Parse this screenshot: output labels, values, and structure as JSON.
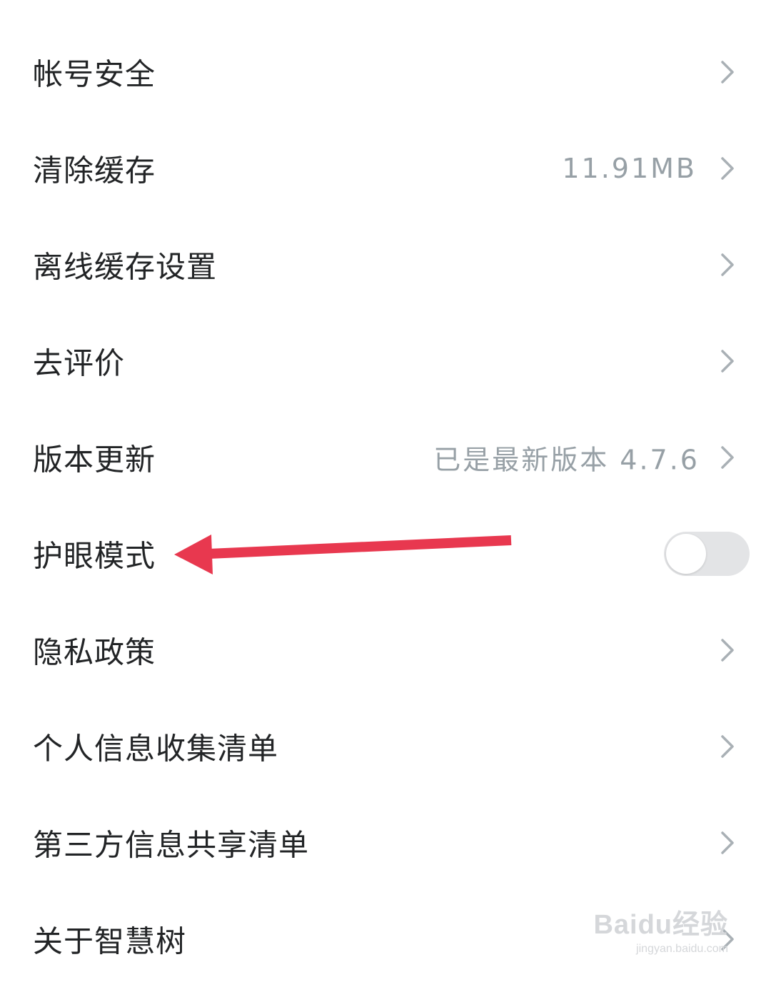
{
  "settings": {
    "rows": [
      {
        "label": "帐号安全",
        "value": ""
      },
      {
        "label": "清除缓存",
        "value": "11.91MB"
      },
      {
        "label": "离线缓存设置",
        "value": ""
      },
      {
        "label": "去评价",
        "value": ""
      },
      {
        "label": "版本更新",
        "value": "已是最新版本  4.7.6"
      },
      {
        "label": "护眼模式",
        "toggle_on": false
      },
      {
        "label": "隐私政策",
        "value": ""
      },
      {
        "label": "个人信息收集清单",
        "value": ""
      },
      {
        "label": "第三方信息共享清单",
        "value": ""
      },
      {
        "label": "关于智慧树",
        "value": ""
      }
    ]
  },
  "annotation": {
    "arrow_color": "#e8384f"
  },
  "watermark": {
    "brand": "Baidu经验",
    "url": "jingyan.baidu.com"
  },
  "icons": {
    "chevron": "chevron-right-icon",
    "arrow": "red-arrow-annotation"
  },
  "colors": {
    "label_text": "#222426",
    "value_text": "#97a0a6",
    "chevron": "#a9b0b5",
    "toggle_off_track": "#e3e4e6"
  }
}
